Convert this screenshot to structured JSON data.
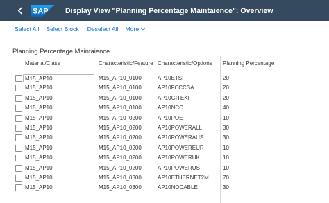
{
  "shell": {
    "back_icon": "chevron-left-icon",
    "logo_text": "SAP",
    "title": "Display View \"Planning Percentage Maintaience\": Overview"
  },
  "toolbar": {
    "select_all": "Select All",
    "select_block": "Select Block",
    "deselect_all": "Deselect All",
    "more": "More",
    "more_icon": "chevron-down-icon"
  },
  "section": {
    "title": "Planning Percentage Maintaience"
  },
  "table": {
    "columns": [
      "Material/Class",
      "Characteristic/Feature",
      "Characteristic/Options",
      "Planning Percentage"
    ],
    "rows": [
      [
        "M15_AP10",
        "M15_AP10_0100",
        "AP10ETSI",
        "20"
      ],
      [
        "M15_AP10",
        "M15_AP10_0100",
        "AP10FCCCSA",
        "20"
      ],
      [
        "M15_AP10",
        "M15_AP10_0100",
        "AP10GITEKI",
        "20"
      ],
      [
        "M15_AP10",
        "M15_AP10_0100",
        "AP10NCC",
        "40"
      ],
      [
        "M15_AP10",
        "M15_AP10_0200",
        "AP10POE",
        "10"
      ],
      [
        "M15_AP10",
        "M15_AP10_0200",
        "AP10POWERALL",
        "30"
      ],
      [
        "M15_AP10",
        "M15_AP10_0200",
        "AP10POWERAUS",
        "30"
      ],
      [
        "M15_AP10",
        "M15_AP10_0200",
        "AP10POWEREUR",
        "10"
      ],
      [
        "M15_AP10",
        "M15_AP10_0200",
        "AP10POWERUK",
        "10"
      ],
      [
        "M15_AP10",
        "M15_AP10_0200",
        "AP10POWERUS",
        "10"
      ],
      [
        "M15_AP10",
        "M15_AP10_0300",
        "AP10ETHERNET2M",
        "70"
      ],
      [
        "M15_AP10",
        "M15_AP10_0300",
        "AP10NOCABLE",
        "30"
      ]
    ]
  },
  "colors": {
    "shell_bg": "#354a5f",
    "link": "#0a6ed1",
    "logo_blue": "#0f7fd8"
  }
}
